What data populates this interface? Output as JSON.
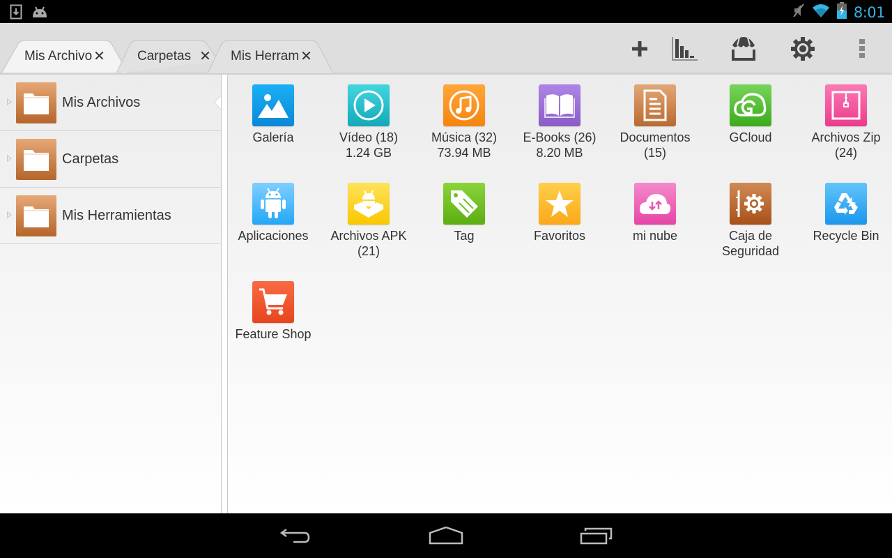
{
  "status_bar": {
    "time": "8:01",
    "time_color": "#33b5e5",
    "left_icons": [
      "download-icon",
      "android-icon"
    ],
    "right_icons": [
      "muted-icon",
      "wifi-icon",
      "battery-charging-icon"
    ]
  },
  "tabs": [
    {
      "label": "Mis Archivos",
      "display": "Mis Archivo",
      "active": true
    },
    {
      "label": "Carpetas",
      "display": "Carpetas",
      "active": false
    },
    {
      "label": "Mis Herramientas",
      "display": "Mis Herram",
      "active": false
    }
  ],
  "tab_close_glyph": "✕",
  "actions": [
    {
      "name": "add-button",
      "icon": "plus-icon"
    },
    {
      "name": "analyze-button",
      "icon": "bar-chart-icon"
    },
    {
      "name": "store-button",
      "icon": "store-icon"
    },
    {
      "name": "settings-button",
      "icon": "gear-icon"
    },
    {
      "name": "overflow-menu-button",
      "icon": "more-vertical-icon"
    }
  ],
  "sidebar": {
    "items": [
      {
        "label": "Mis Archivos",
        "selected": true
      },
      {
        "label": "Carpetas",
        "selected": false
      },
      {
        "label": "Mis Herramientas",
        "selected": false
      }
    ]
  },
  "tiles": [
    {
      "label": "Galería",
      "icon": "gallery-icon",
      "colors": [
        "#1ab0f5",
        "#0a88d8"
      ]
    },
    {
      "label": "Vídeo (18)\n1.24 GB",
      "icon": "video-icon",
      "colors": [
        "#42d6e0",
        "#14a9b8"
      ]
    },
    {
      "label": "Música (32)\n73.94 MB",
      "icon": "music-icon",
      "colors": [
        "#ffa63a",
        "#f5850f"
      ]
    },
    {
      "label": "E-Books (26)\n8.20 MB",
      "icon": "book-icon",
      "colors": [
        "#ae85e6",
        "#8b5cc9"
      ]
    },
    {
      "label": "Documentos\n(15)",
      "icon": "document-icon",
      "colors": [
        "#e2a878",
        "#b96a30"
      ]
    },
    {
      "label": "GCloud",
      "icon": "gcloud-icon",
      "colors": [
        "#78d45a",
        "#3cab1a"
      ]
    },
    {
      "label": "Archivos Zip\n(24)",
      "icon": "zip-icon",
      "colors": [
        "#fb7ab4",
        "#ec3b8d"
      ]
    },
    {
      "label": "Aplicaciones",
      "icon": "android-app-icon",
      "colors": [
        "#80cfff",
        "#24a7f7"
      ]
    },
    {
      "label": "Archivos APK\n(21)",
      "icon": "apk-icon",
      "colors": [
        "#ffe25a",
        "#f8c800"
      ]
    },
    {
      "label": "Tag",
      "icon": "tag-icon",
      "colors": [
        "#8ad43a",
        "#5cae12"
      ]
    },
    {
      "label": "Favoritos",
      "icon": "star-icon",
      "colors": [
        "#ffcf4a",
        "#fba81a"
      ]
    },
    {
      "label": "mi nube",
      "icon": "cloud-transfer-icon",
      "colors": [
        "#f48acb",
        "#e645a6"
      ]
    },
    {
      "label": "Caja de\nSeguridad",
      "icon": "safe-box-icon",
      "colors": [
        "#d08a55",
        "#a85018"
      ]
    },
    {
      "label": "Recycle Bin",
      "icon": "recycle-icon",
      "colors": [
        "#62c4fa",
        "#1c97ec"
      ]
    },
    {
      "label": "Feature Shop",
      "icon": "cart-icon",
      "colors": [
        "#f76b45",
        "#e8451c"
      ]
    }
  ],
  "nav_bar": [
    {
      "name": "back-button",
      "icon": "back-icon"
    },
    {
      "name": "home-button",
      "icon": "home-icon"
    },
    {
      "name": "recents-button",
      "icon": "recents-icon"
    }
  ]
}
